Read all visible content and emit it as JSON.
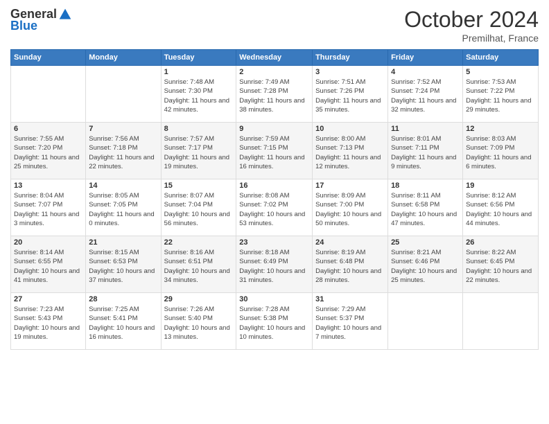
{
  "header": {
    "logo_general": "General",
    "logo_blue": "Blue",
    "month_title": "October 2024",
    "subtitle": "Premilhat, France"
  },
  "days_of_week": [
    "Sunday",
    "Monday",
    "Tuesday",
    "Wednesday",
    "Thursday",
    "Friday",
    "Saturday"
  ],
  "weeks": [
    [
      {
        "day": "",
        "sunrise": "",
        "sunset": "",
        "daylight": ""
      },
      {
        "day": "",
        "sunrise": "",
        "sunset": "",
        "daylight": ""
      },
      {
        "day": "1",
        "sunrise": "Sunrise: 7:48 AM",
        "sunset": "Sunset: 7:30 PM",
        "daylight": "Daylight: 11 hours and 42 minutes."
      },
      {
        "day": "2",
        "sunrise": "Sunrise: 7:49 AM",
        "sunset": "Sunset: 7:28 PM",
        "daylight": "Daylight: 11 hours and 38 minutes."
      },
      {
        "day": "3",
        "sunrise": "Sunrise: 7:51 AM",
        "sunset": "Sunset: 7:26 PM",
        "daylight": "Daylight: 11 hours and 35 minutes."
      },
      {
        "day": "4",
        "sunrise": "Sunrise: 7:52 AM",
        "sunset": "Sunset: 7:24 PM",
        "daylight": "Daylight: 11 hours and 32 minutes."
      },
      {
        "day": "5",
        "sunrise": "Sunrise: 7:53 AM",
        "sunset": "Sunset: 7:22 PM",
        "daylight": "Daylight: 11 hours and 29 minutes."
      }
    ],
    [
      {
        "day": "6",
        "sunrise": "Sunrise: 7:55 AM",
        "sunset": "Sunset: 7:20 PM",
        "daylight": "Daylight: 11 hours and 25 minutes."
      },
      {
        "day": "7",
        "sunrise": "Sunrise: 7:56 AM",
        "sunset": "Sunset: 7:18 PM",
        "daylight": "Daylight: 11 hours and 22 minutes."
      },
      {
        "day": "8",
        "sunrise": "Sunrise: 7:57 AM",
        "sunset": "Sunset: 7:17 PM",
        "daylight": "Daylight: 11 hours and 19 minutes."
      },
      {
        "day": "9",
        "sunrise": "Sunrise: 7:59 AM",
        "sunset": "Sunset: 7:15 PM",
        "daylight": "Daylight: 11 hours and 16 minutes."
      },
      {
        "day": "10",
        "sunrise": "Sunrise: 8:00 AM",
        "sunset": "Sunset: 7:13 PM",
        "daylight": "Daylight: 11 hours and 12 minutes."
      },
      {
        "day": "11",
        "sunrise": "Sunrise: 8:01 AM",
        "sunset": "Sunset: 7:11 PM",
        "daylight": "Daylight: 11 hours and 9 minutes."
      },
      {
        "day": "12",
        "sunrise": "Sunrise: 8:03 AM",
        "sunset": "Sunset: 7:09 PM",
        "daylight": "Daylight: 11 hours and 6 minutes."
      }
    ],
    [
      {
        "day": "13",
        "sunrise": "Sunrise: 8:04 AM",
        "sunset": "Sunset: 7:07 PM",
        "daylight": "Daylight: 11 hours and 3 minutes."
      },
      {
        "day": "14",
        "sunrise": "Sunrise: 8:05 AM",
        "sunset": "Sunset: 7:05 PM",
        "daylight": "Daylight: 11 hours and 0 minutes."
      },
      {
        "day": "15",
        "sunrise": "Sunrise: 8:07 AM",
        "sunset": "Sunset: 7:04 PM",
        "daylight": "Daylight: 10 hours and 56 minutes."
      },
      {
        "day": "16",
        "sunrise": "Sunrise: 8:08 AM",
        "sunset": "Sunset: 7:02 PM",
        "daylight": "Daylight: 10 hours and 53 minutes."
      },
      {
        "day": "17",
        "sunrise": "Sunrise: 8:09 AM",
        "sunset": "Sunset: 7:00 PM",
        "daylight": "Daylight: 10 hours and 50 minutes."
      },
      {
        "day": "18",
        "sunrise": "Sunrise: 8:11 AM",
        "sunset": "Sunset: 6:58 PM",
        "daylight": "Daylight: 10 hours and 47 minutes."
      },
      {
        "day": "19",
        "sunrise": "Sunrise: 8:12 AM",
        "sunset": "Sunset: 6:56 PM",
        "daylight": "Daylight: 10 hours and 44 minutes."
      }
    ],
    [
      {
        "day": "20",
        "sunrise": "Sunrise: 8:14 AM",
        "sunset": "Sunset: 6:55 PM",
        "daylight": "Daylight: 10 hours and 41 minutes."
      },
      {
        "day": "21",
        "sunrise": "Sunrise: 8:15 AM",
        "sunset": "Sunset: 6:53 PM",
        "daylight": "Daylight: 10 hours and 37 minutes."
      },
      {
        "day": "22",
        "sunrise": "Sunrise: 8:16 AM",
        "sunset": "Sunset: 6:51 PM",
        "daylight": "Daylight: 10 hours and 34 minutes."
      },
      {
        "day": "23",
        "sunrise": "Sunrise: 8:18 AM",
        "sunset": "Sunset: 6:49 PM",
        "daylight": "Daylight: 10 hours and 31 minutes."
      },
      {
        "day": "24",
        "sunrise": "Sunrise: 8:19 AM",
        "sunset": "Sunset: 6:48 PM",
        "daylight": "Daylight: 10 hours and 28 minutes."
      },
      {
        "day": "25",
        "sunrise": "Sunrise: 8:21 AM",
        "sunset": "Sunset: 6:46 PM",
        "daylight": "Daylight: 10 hours and 25 minutes."
      },
      {
        "day": "26",
        "sunrise": "Sunrise: 8:22 AM",
        "sunset": "Sunset: 6:45 PM",
        "daylight": "Daylight: 10 hours and 22 minutes."
      }
    ],
    [
      {
        "day": "27",
        "sunrise": "Sunrise: 7:23 AM",
        "sunset": "Sunset: 5:43 PM",
        "daylight": "Daylight: 10 hours and 19 minutes."
      },
      {
        "day": "28",
        "sunrise": "Sunrise: 7:25 AM",
        "sunset": "Sunset: 5:41 PM",
        "daylight": "Daylight: 10 hours and 16 minutes."
      },
      {
        "day": "29",
        "sunrise": "Sunrise: 7:26 AM",
        "sunset": "Sunset: 5:40 PM",
        "daylight": "Daylight: 10 hours and 13 minutes."
      },
      {
        "day": "30",
        "sunrise": "Sunrise: 7:28 AM",
        "sunset": "Sunset: 5:38 PM",
        "daylight": "Daylight: 10 hours and 10 minutes."
      },
      {
        "day": "31",
        "sunrise": "Sunrise: 7:29 AM",
        "sunset": "Sunset: 5:37 PM",
        "daylight": "Daylight: 10 hours and 7 minutes."
      },
      {
        "day": "",
        "sunrise": "",
        "sunset": "",
        "daylight": ""
      },
      {
        "day": "",
        "sunrise": "",
        "sunset": "",
        "daylight": ""
      }
    ]
  ]
}
